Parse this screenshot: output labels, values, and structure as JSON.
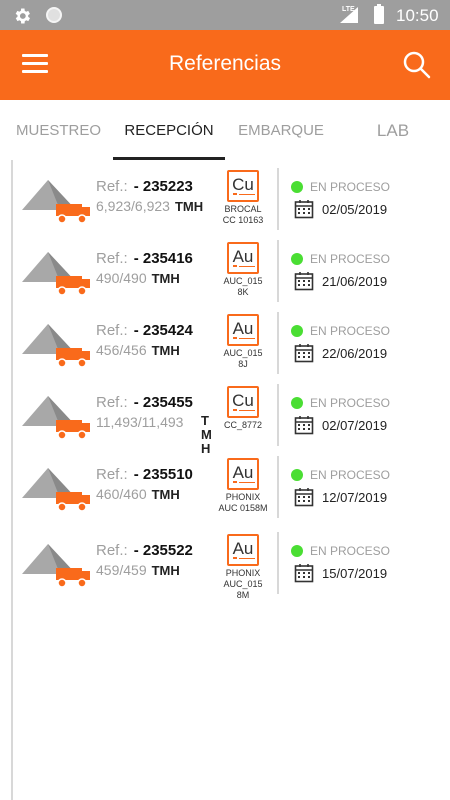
{
  "status_bar": {
    "time": "10:50",
    "network": "LTE",
    "icons": [
      "gear-icon",
      "circle-icon",
      "signal-icon",
      "battery-icon"
    ]
  },
  "app_bar": {
    "title": "Referencias",
    "icons": [
      "menu-icon",
      "search-icon"
    ]
  },
  "tabs": [
    {
      "label": "MUESTREO",
      "active": false
    },
    {
      "label": "RECEPCIÓN",
      "active": true
    },
    {
      "label": "EMBARQUE",
      "active": false
    },
    {
      "label": "LAB",
      "active": false
    }
  ],
  "list": {
    "ref_label": "Ref.:",
    "items": [
      {
        "ref": "- 235223",
        "qty": "6,923/6,923",
        "unit": "TMH",
        "element": "Cu",
        "element_name": "BROCAL CC 10163",
        "status": "EN PROCESO",
        "date": "02/05/2019"
      },
      {
        "ref": "- 235416",
        "qty": "490/490",
        "unit": "TMH",
        "element": "Au",
        "element_name": "AUC_015 8K",
        "status": "EN PROCESO",
        "date": "21/06/2019"
      },
      {
        "ref": "- 235424",
        "qty": "456/456",
        "unit": "TMH",
        "element": "Au",
        "element_name": "AUC_015 8J",
        "status": "EN PROCESO",
        "date": "22/06/2019"
      },
      {
        "ref": "- 235455",
        "qty": "11,493/11,493",
        "unit": "TMH",
        "element": "Cu",
        "element_name": "CC_8772",
        "status": "EN PROCESO",
        "date": "02/07/2019"
      },
      {
        "ref": "- 235510",
        "qty": "460/460",
        "unit": "TMH",
        "element": "Au",
        "element_name": "PHONIX AUC 0158M",
        "status": "EN PROCESO",
        "date": "12/07/2019"
      },
      {
        "ref": "- 235522",
        "qty": "459/459",
        "unit": "TMH",
        "element": "Au",
        "element_name": "PHONIX AUC_015 8M",
        "status": "EN PROCESO",
        "date": "15/07/2019"
      }
    ]
  },
  "colors": {
    "accent": "#f96a1b",
    "status_green": "#4ade33",
    "status_bar": "#9e9e9e"
  }
}
